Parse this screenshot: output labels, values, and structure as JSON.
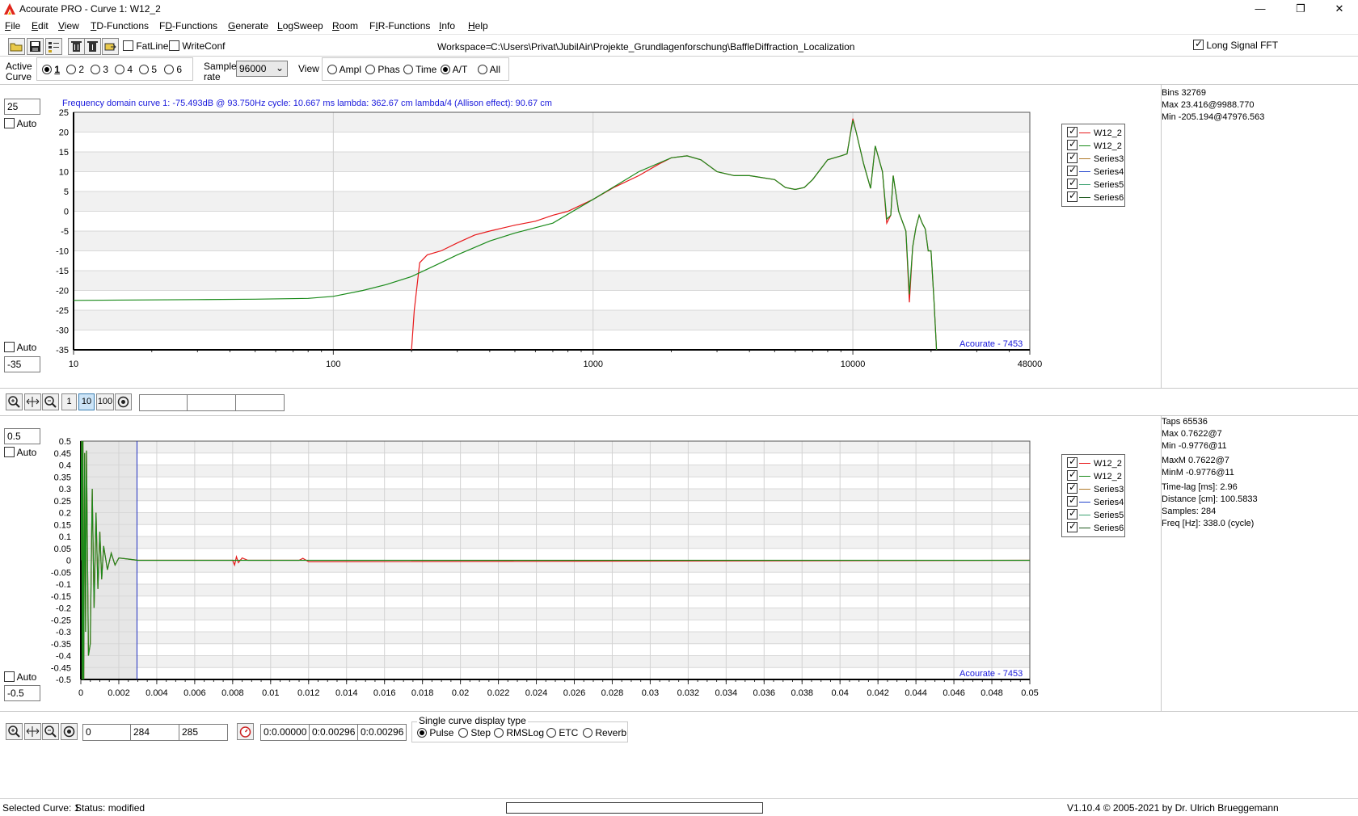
{
  "window": {
    "title": "Acourate PRO - Curve 1: W12_2",
    "minimize": "—",
    "maximize": "❐",
    "close": "✕"
  },
  "menu": [
    {
      "pre": "",
      "ul": "F",
      "post": "ile"
    },
    {
      "pre": "",
      "ul": "E",
      "post": "dit"
    },
    {
      "pre": "",
      "ul": "V",
      "post": "iew"
    },
    {
      "pre": "",
      "ul": "T",
      "post": "D-Functions"
    },
    {
      "pre": "F",
      "ul": "D",
      "post": "-Functions"
    },
    {
      "pre": "",
      "ul": "G",
      "post": "enerate"
    },
    {
      "pre": "",
      "ul": "L",
      "post": "ogSweep"
    },
    {
      "pre": "",
      "ul": "R",
      "post": "oom"
    },
    {
      "pre": "F",
      "ul": "I",
      "post": "R-Functions"
    },
    {
      "pre": "",
      "ul": "I",
      "post": "nfo"
    },
    {
      "pre": "",
      "ul": "H",
      "post": "elp"
    }
  ],
  "toolbar": {
    "fatline_label": "FatLine",
    "writeconf_label": "WriteConf",
    "workspace_label": "Workspace=",
    "workspace_path": "C:\\Users\\Privat\\JubilAir\\Projekte_Grundlagenforschung\\BaffleDiffraction_Localization",
    "long_signal_label": "Long Signal FFT"
  },
  "curve_bar": {
    "active_curve_label_1": "Active",
    "active_curve_label_2": "Curve",
    "curves": [
      "1",
      "2",
      "3",
      "4",
      "5",
      "6"
    ],
    "selected_curve": "1",
    "sample_rate_label_1": "Sample",
    "sample_rate_label_2": "rate",
    "sample_rate_value": "96000",
    "view_label": "View",
    "views": [
      "Ampl",
      "Phas",
      "Time",
      "A/T",
      "All"
    ],
    "selected_view": "A/T"
  },
  "top_panel": {
    "ymax_value": "25",
    "ymin_value": "-35",
    "auto_label": "Auto",
    "header": "Frequency domain curve 1:  -75.493dB @ 93.750Hz    cycle: 10.667 ms    lambda: 362.67 cm   lambda/4 (Allison effect): 90.67 cm",
    "watermark": "Acourate - 7453",
    "info": [
      "Bins 32769",
      "Max 23.416@9988.770",
      "Min -205.194@47976.563"
    ]
  },
  "mid_toolbar": {
    "btn_1": "1",
    "btn_10": "10",
    "btn_100": "100",
    "fields": [
      "",
      "",
      ""
    ]
  },
  "bottom_panel": {
    "ymax_value": "0.5",
    "ymin_value": "-0.5",
    "auto_label": "Auto",
    "watermark": "Acourate - 7453",
    "info": [
      "Taps 65536",
      "Max 0.7622@7",
      "Min -0.9776@11",
      "MaxM 0.7622@7",
      "MinM -0.9776@11",
      "Time-lag [ms]: 2.96",
      "Distance [cm]: 100.5833",
      "Samples:  284",
      "Freq [Hz]: 338.0 (cycle)"
    ]
  },
  "legend": [
    {
      "name": "W12_2",
      "color": "#e8191b"
    },
    {
      "name": "W12_2",
      "color": "#1a8a1a"
    },
    {
      "name": "Series3",
      "color": "#b07a2a"
    },
    {
      "name": "Series4",
      "color": "#2244cc"
    },
    {
      "name": "Series5",
      "color": "#3aa070"
    },
    {
      "name": "Series6",
      "color": "#1e5a1e"
    }
  ],
  "bottom_toolbar": {
    "fields_samples": [
      "0",
      "284",
      "285"
    ],
    "fields_time": [
      "0:0.00000",
      "0:0.00296",
      "0:0.00296"
    ],
    "display_type_title": "Single curve display type",
    "display_types": [
      "Pulse",
      "Step",
      "RMSLog",
      "ETC",
      "Reverb"
    ],
    "selected_display_type": "Pulse"
  },
  "status": {
    "selected_curve": "Selected Curve: 1",
    "status_text": "Status: modified",
    "version": "V1.10.4 © 2005-2021 by Dr. Ulrich Brueggemann"
  },
  "chart_data": [
    {
      "type": "line",
      "title": "",
      "xlabel": "",
      "ylabel": "",
      "xscale": "log",
      "xlim": [
        10,
        48000
      ],
      "ylim": [
        -35,
        25
      ],
      "x_tick_labels": [
        "10",
        "100",
        "1000",
        "10000",
        "48000"
      ],
      "y_tick_labels": [
        "25",
        "20",
        "15",
        "10",
        "5",
        "0",
        "-5",
        "-10",
        "-15",
        "-20",
        "-25",
        "-30",
        "-35"
      ],
      "grid": true,
      "legend_position": "right",
      "series": [
        {
          "name": "W12_2",
          "color": "#e8191b",
          "x": [
            200,
            205,
            215,
            230,
            260,
            300,
            350,
            400,
            500,
            600,
            700,
            800,
            1000,
            1200,
            1500,
            1800,
            2000,
            2300,
            2600,
            3000,
            3500,
            4000,
            5000,
            5500,
            6000,
            6500,
            7000,
            8000,
            9000,
            9500,
            10000,
            10300,
            11000,
            11700,
            12200,
            13000,
            13500,
            14000,
            14300,
            15000,
            16000,
            16500,
            17000,
            17500,
            18000,
            18500,
            19000,
            19500,
            20000,
            20500,
            21000
          ],
          "y": [
            -35,
            -25,
            -13,
            -11,
            -10,
            -8,
            -6,
            -5,
            -3.5,
            -2.5,
            -1,
            0,
            3,
            6,
            9,
            12,
            13.5,
            14,
            13,
            10,
            9,
            9,
            8,
            6,
            5.5,
            6,
            8,
            13,
            14,
            14.5,
            23.4,
            20,
            12,
            5.8,
            16.5,
            10,
            -3,
            -1,
            9,
            0,
            -5,
            -23,
            -9,
            -4,
            -1,
            -3,
            -4.5,
            -10,
            -10,
            -22,
            -35
          ]
        },
        {
          "name": "W12_2",
          "color": "#1a8a1a",
          "x": [
            10,
            30,
            50,
            80,
            100,
            130,
            160,
            200,
            250,
            300,
            400,
            500,
            700,
            1000,
            1500,
            2000,
            2300,
            2600,
            3000,
            3500,
            4000,
            5000,
            5500,
            6000,
            6500,
            7000,
            8000,
            9000,
            9500,
            10000,
            10300,
            11000,
            11700,
            12200,
            13000,
            13500,
            14000,
            14300,
            15000,
            16000,
            16500,
            17000,
            17500,
            18000,
            18500,
            19000,
            19500,
            20000,
            20500,
            21000
          ],
          "y": [
            -22.5,
            -22.3,
            -22.2,
            -22,
            -21.5,
            -20,
            -18.5,
            -16.5,
            -13.5,
            -11,
            -7.5,
            -5.5,
            -3,
            3,
            10,
            13.5,
            14,
            13,
            10,
            9,
            9,
            8,
            6,
            5.5,
            6,
            8,
            13,
            14,
            14.5,
            23,
            20,
            12,
            5.8,
            16.5,
            10,
            -2,
            -1,
            9,
            0,
            -5,
            -21,
            -9,
            -4,
            -1,
            -3,
            -4.5,
            -10,
            -10,
            -22,
            -35
          ]
        }
      ]
    },
    {
      "type": "line",
      "title": "",
      "xlabel": "",
      "ylabel": "",
      "xlim": [
        0,
        0.05
      ],
      "ylim": [
        -0.5,
        0.5
      ],
      "x_tick_labels": [
        "0",
        "0.002",
        "0.004",
        "0.006",
        "0.008",
        "0.01",
        "0.012",
        "0.014",
        "0.016",
        "0.018",
        "0.02",
        "0.022",
        "0.024",
        "0.026",
        "0.028",
        "0.03",
        "0.032",
        "0.034",
        "0.036",
        "0.038",
        "0.04",
        "0.042",
        "0.044",
        "0.046",
        "0.048",
        "0.05"
      ],
      "y_tick_labels": [
        "0.5",
        "0.45",
        "0.4",
        "0.35",
        "0.3",
        "0.25",
        "0.2",
        "0.15",
        "0.1",
        "0.05",
        "0",
        "-0.05",
        "-0.1",
        "-0.15",
        "-0.2",
        "-0.25",
        "-0.3",
        "-0.35",
        "-0.4",
        "-0.45",
        "-0.5"
      ],
      "grid": true,
      "legend_position": "right",
      "marker_time": 0.00296,
      "series": [
        {
          "name": "W12_2",
          "color": "#e8191b",
          "x": [
            0,
            5e-05,
            8e-05,
            0.00011,
            0.00015,
            0.0002,
            0.00025,
            0.0003,
            0.0004,
            0.0005,
            0.0006,
            0.0007,
            0.0008,
            0.0009,
            0.001,
            0.0011,
            0.0012,
            0.0014,
            0.0016,
            0.0018,
            0.002,
            0.0025,
            0.003,
            0.008,
            0.0081,
            0.0082,
            0.0083,
            0.0085,
            0.0088,
            0.0115,
            0.0117,
            0.012,
            0.05
          ],
          "y": [
            0,
            0.76,
            -0.98,
            0.5,
            -0.6,
            0.45,
            -0.3,
            0.46,
            -0.4,
            -0.35,
            0.3,
            -0.2,
            0.2,
            -0.12,
            0.12,
            -0.08,
            0.06,
            -0.04,
            0.03,
            -0.02,
            0.01,
            0.005,
            0,
            0,
            -0.02,
            0.015,
            -0.01,
            0.01,
            0,
            0,
            0.008,
            -0.006,
            0
          ]
        },
        {
          "name": "W12_2",
          "color": "#1a8a1a",
          "x": [
            0,
            5e-05,
            8e-05,
            0.00011,
            0.00015,
            0.0002,
            0.00025,
            0.0003,
            0.0004,
            0.0005,
            0.0006,
            0.0007,
            0.0008,
            0.0009,
            0.001,
            0.0011,
            0.0012,
            0.0014,
            0.0016,
            0.0018,
            0.002,
            0.0025,
            0.003,
            0.05
          ],
          "y": [
            0,
            0.76,
            -0.98,
            0.5,
            -0.6,
            0.45,
            -0.3,
            0.46,
            -0.4,
            -0.35,
            0.3,
            -0.2,
            0.2,
            -0.12,
            0.12,
            -0.08,
            0.06,
            -0.04,
            0.03,
            -0.02,
            0.01,
            0.005,
            0,
            0
          ]
        }
      ]
    }
  ]
}
